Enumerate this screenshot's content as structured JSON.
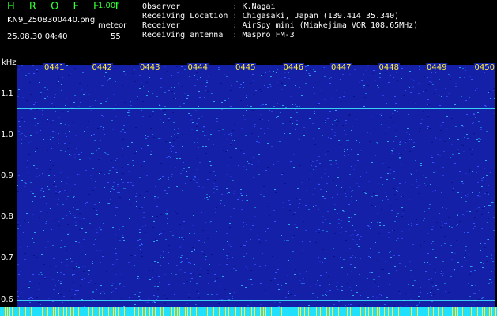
{
  "header": {
    "app_name": "H R O F F T",
    "version": "1.00f",
    "filename": "KN9_2508300440.png",
    "datetime": "25.08.30 04:40",
    "meteor_label": "meteor",
    "meteor_value": "55"
  },
  "info": [
    {
      "label": "Observer           : ",
      "value": "K.Nagai"
    },
    {
      "label": "Receiving Location : ",
      "value": "Chigasaki, Japan (139.414 35.340)"
    },
    {
      "label": "Receiver           : ",
      "value": "AirSpy mini (Miakejima VOR 108.65MHz)"
    },
    {
      "label": "Receiving antenna  : ",
      "value": "Maspro FM-3"
    }
  ],
  "spectrogram": {
    "y_unit": "kHz",
    "y_ticks": [
      "1.1",
      "1.0",
      "0.9",
      "0.8",
      "0.7",
      "0.6"
    ],
    "x_ticks": [
      "0441",
      "0442",
      "0443",
      "0444",
      "0445",
      "0446",
      "0447",
      "0448",
      "0449",
      "0450"
    ],
    "ylim": [
      0.58,
      1.17
    ],
    "line_freqs_khz": [
      1.115,
      1.105,
      1.065,
      0.95,
      0.62,
      0.6
    ],
    "colors": {
      "background": "#1420a8",
      "line": "#40f0ff",
      "tick": "#ffee33",
      "base": "#20e0ff"
    }
  }
}
